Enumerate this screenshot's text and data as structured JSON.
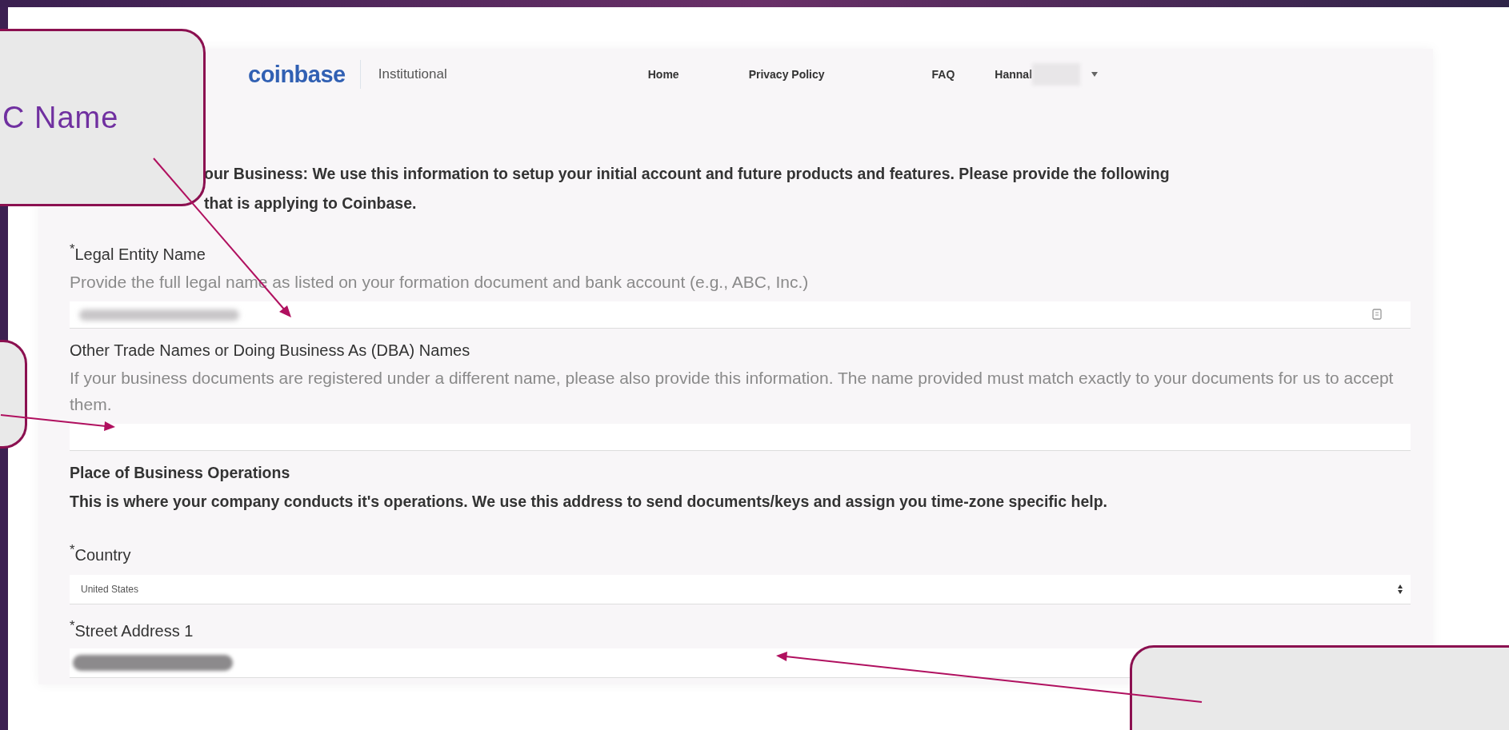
{
  "callout": {
    "text": "C Name"
  },
  "header": {
    "logo": "coinbase",
    "product": "Institutional",
    "nav": [
      {
        "label": "Home"
      },
      {
        "label": "Privacy Policy"
      },
      {
        "label": "FAQ"
      }
    ],
    "user": "Hannal"
  },
  "intro": {
    "lines": [
      "our Business: We use this information to setup your initial account and future products and features. Please provide the following",
      "that is applying to Coinbase."
    ]
  },
  "fields": [
    {
      "kind": "text",
      "label": "$^{*}$Legal Entity Name",
      "hint": "Provide the full legal name as listed on your formation document and bank account (e.g., ABC, Inc.)",
      "redacted": true,
      "autofill_icon": true
    },
    {
      "kind": "text",
      "label": "Other Trade Names or Doing Business As (DBA) Names",
      "hint": "If your business documents are registered under a different name, please also provide this information. The name provided must match exactly to your documents for us to accept them.",
      "redacted": false,
      "autofill_icon": false
    },
    {
      "kind": "section",
      "title": "Place of Business Operations",
      "text": "This is where your company conducts it's operations. We use this address to send documents/keys and assign you time-zone specific help."
    },
    {
      "kind": "select",
      "label": "$^{*}$Country",
      "value": "United States"
    },
    {
      "kind": "text",
      "label": "$^{*}$Street Address 1",
      "redacted": true,
      "autofill_icon": false
    }
  ]
}
